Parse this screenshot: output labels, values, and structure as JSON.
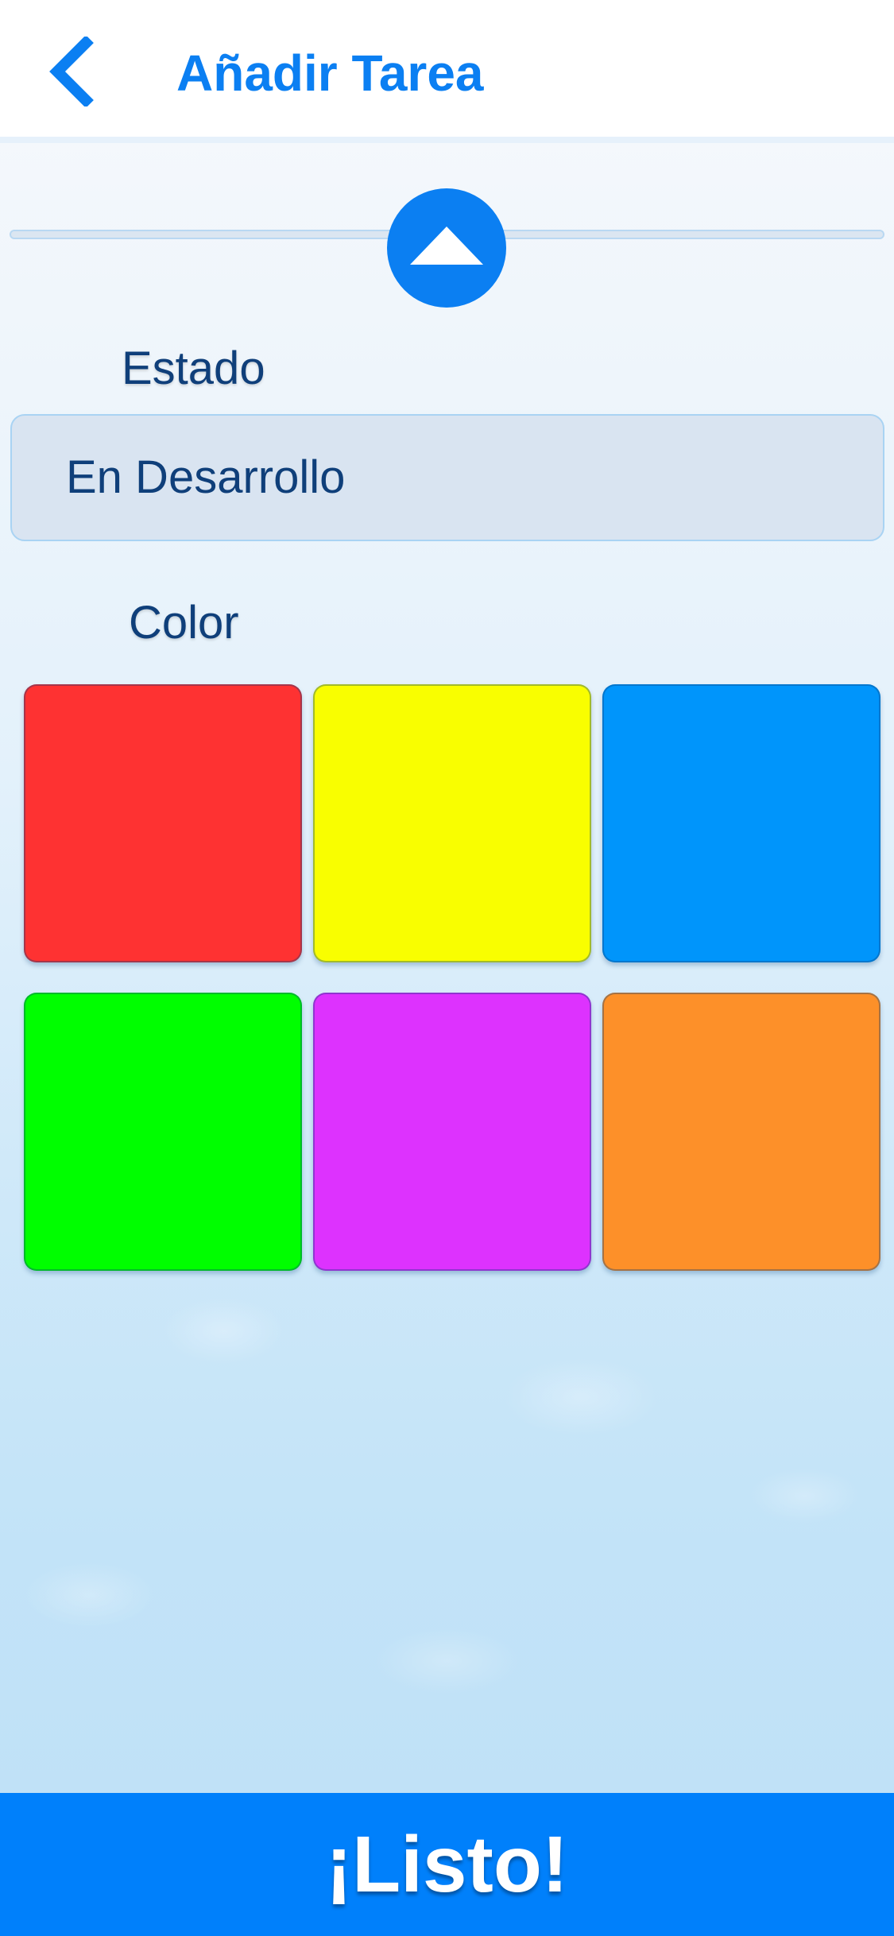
{
  "header": {
    "title": "Añadir Tarea",
    "back_icon": "chevron-left-icon"
  },
  "drag_handle": {
    "icon": "triangle-up-icon"
  },
  "estado": {
    "label": "Estado",
    "value": "En Desarrollo"
  },
  "color": {
    "label": "Color",
    "swatches": [
      {
        "name": "red",
        "hex": "#fe3232"
      },
      {
        "name": "yellow",
        "hex": "#f9fe00"
      },
      {
        "name": "blue",
        "hex": "#0095fb"
      },
      {
        "name": "green",
        "hex": "#00fe00"
      },
      {
        "name": "purple",
        "hex": "#dd32fe"
      },
      {
        "name": "orange",
        "hex": "#fd9029"
      }
    ]
  },
  "footer": {
    "done_label": "¡Listo!"
  },
  "colors": {
    "accent": "#0b7ff2",
    "footer_bg": "#0080fb",
    "label_text": "#0f3f7a",
    "field_bg": "#d9e4f1"
  }
}
